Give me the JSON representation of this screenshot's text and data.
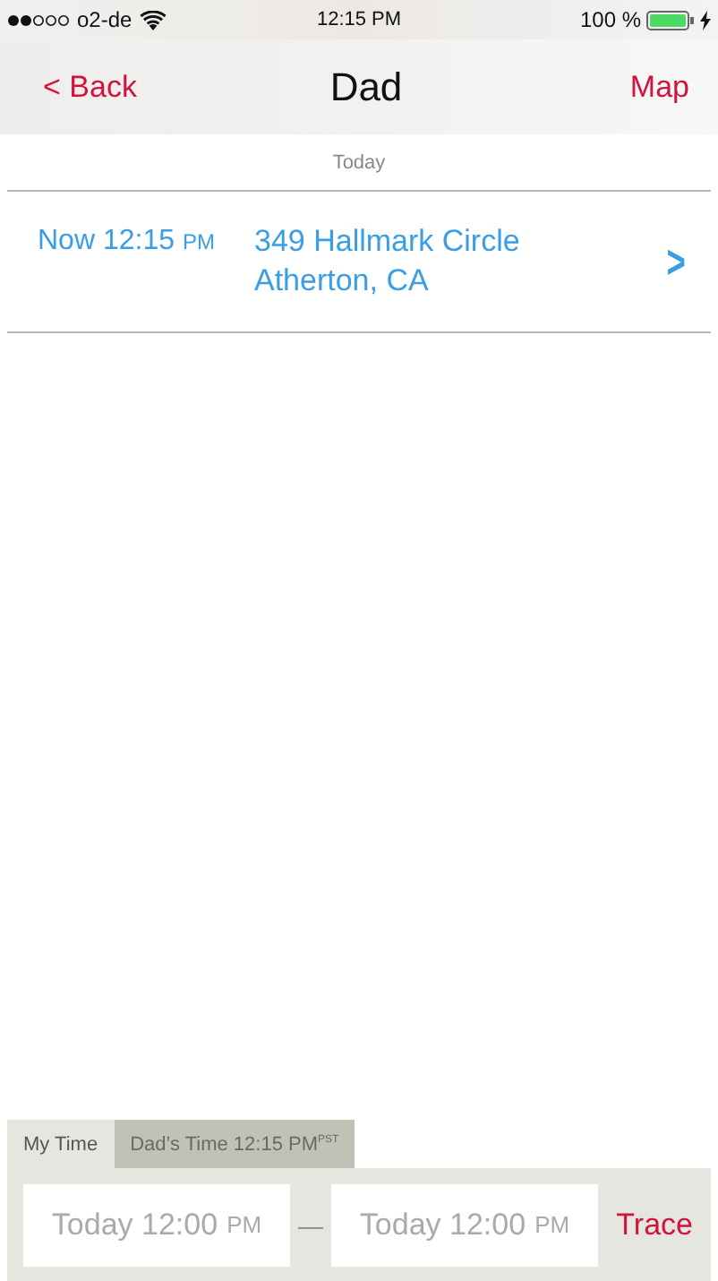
{
  "status_bar": {
    "carrier": "o2-de",
    "time": "12:15 PM",
    "battery": "100 %",
    "charging": true
  },
  "nav": {
    "back": "< Back",
    "title": "Dad",
    "action": "Map"
  },
  "sections": [
    {
      "header": "Today",
      "rows": [
        {
          "time": "Now 12:15",
          "period": "PM",
          "address_line1": "349 Hallmark Circle",
          "address_line2": "Atherton, CA",
          "chevron": ">"
        }
      ]
    }
  ],
  "tabs": [
    {
      "label": "My Time",
      "selected": true
    },
    {
      "label": "Dad’s Time 12:15 PM$^{PST}$",
      "selected": false
    }
  ],
  "range": {
    "from": {
      "value": "Today 12:00",
      "period": "PM"
    },
    "separator": "—",
    "to": {
      "value": "Today 12:00",
      "period": "PM"
    },
    "button": "Trace"
  }
}
